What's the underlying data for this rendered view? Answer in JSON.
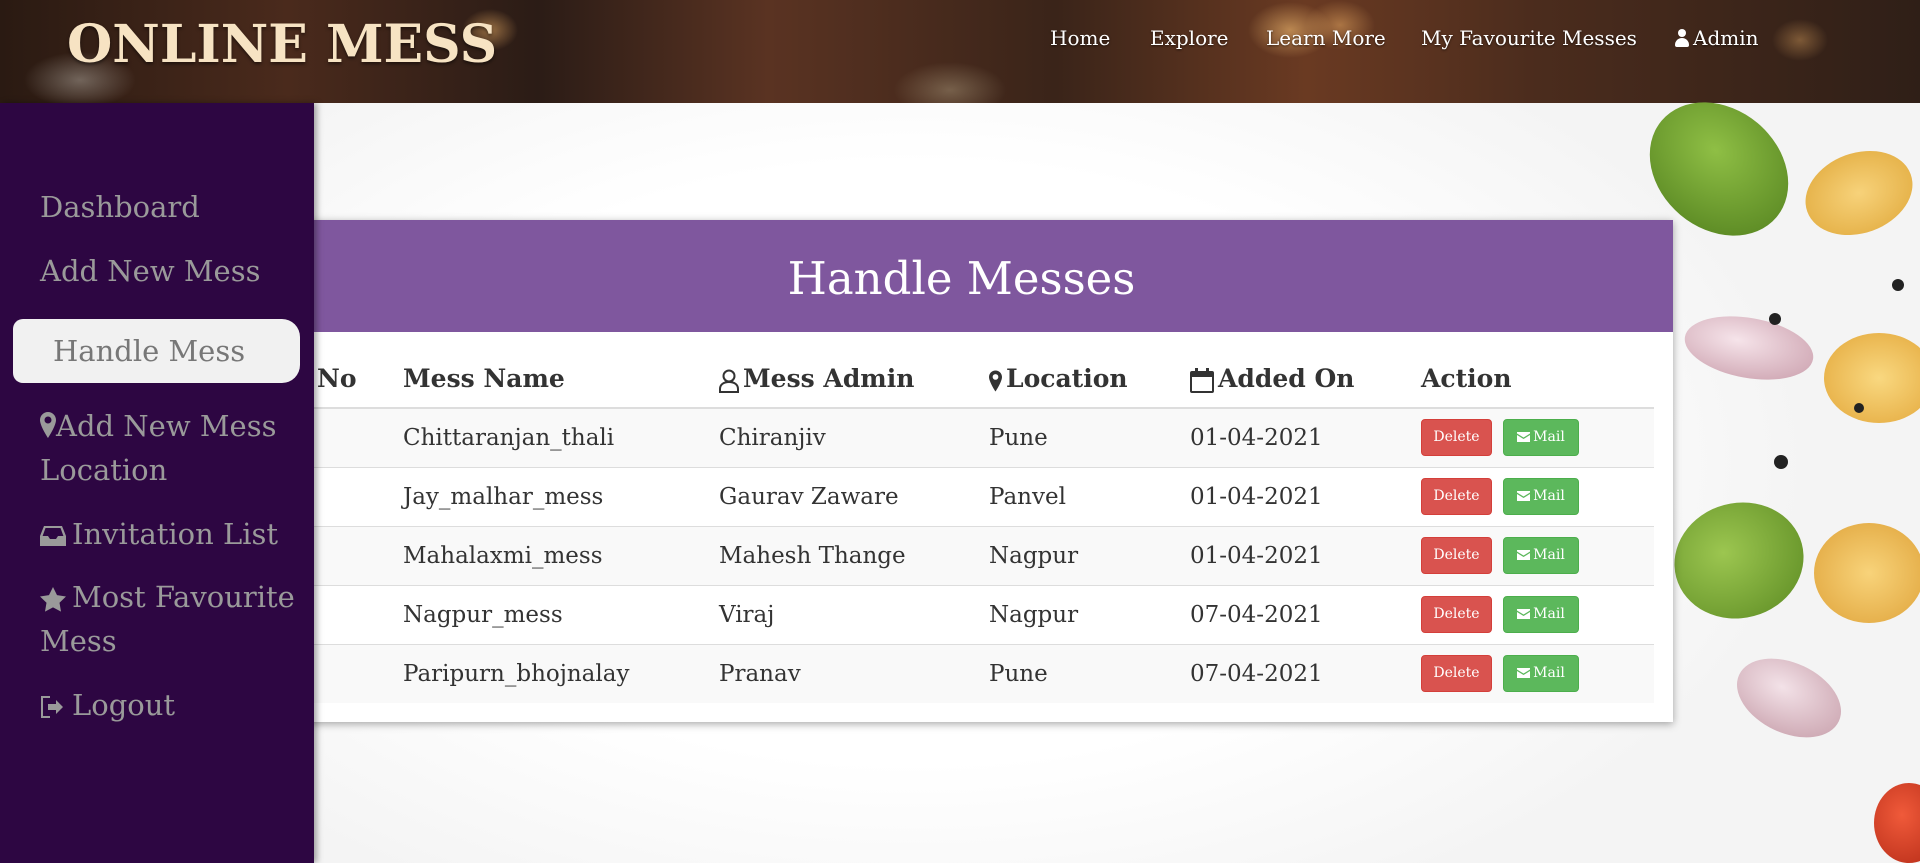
{
  "header": {
    "brand": "ONLINE MESS",
    "nav": [
      {
        "label": "Home"
      },
      {
        "label": "Explore"
      },
      {
        "label": "Learn More"
      },
      {
        "label": "My Favourite Messes"
      },
      {
        "label": "Admin",
        "icon": "user-icon"
      }
    ]
  },
  "sidebar": {
    "items": [
      {
        "label": "Dashboard",
        "icon": null
      },
      {
        "label": "Add New Mess",
        "icon": null
      },
      {
        "label": "Handle Mess",
        "icon": null,
        "active": true
      },
      {
        "label": "Add New Mess Location",
        "icon": "map-marker-icon"
      },
      {
        "label": "Invitation List",
        "icon": "inbox-icon"
      },
      {
        "label": "Most Favourite Mess",
        "icon": "star-icon"
      },
      {
        "label": "Logout",
        "icon": "sign-out-icon"
      }
    ]
  },
  "panel": {
    "title": "Handle Messes",
    "columns": {
      "no": "No",
      "name": "Mess Name",
      "admin": "Mess Admin",
      "location": "Location",
      "added": "Added On",
      "action": "Action"
    },
    "rows": [
      {
        "name": "Chittaranjan_thali",
        "admin": "Chiranjiv",
        "location": "Pune",
        "added": "01-04-2021"
      },
      {
        "name": "Jay_malhar_mess",
        "admin": "Gaurav Zaware",
        "location": "Panvel",
        "added": "01-04-2021"
      },
      {
        "name": "Mahalaxmi_mess",
        "admin": "Mahesh Thange",
        "location": "Nagpur",
        "added": "01-04-2021"
      },
      {
        "name": "Nagpur_mess",
        "admin": "Viraj",
        "location": "Nagpur",
        "added": "07-04-2021"
      },
      {
        "name": "Paripurn_bhojnalay",
        "admin": "Pranav",
        "location": "Pune",
        "added": "07-04-2021"
      }
    ],
    "buttons": {
      "delete": "Delete",
      "mail": "Mail"
    }
  },
  "colors": {
    "sidebar_bg": "#2d0642",
    "panel_header": "#7f579e",
    "delete_button": "#d9534f",
    "mail_button": "#5cb85c",
    "brand_text": "#f7e3c3"
  }
}
